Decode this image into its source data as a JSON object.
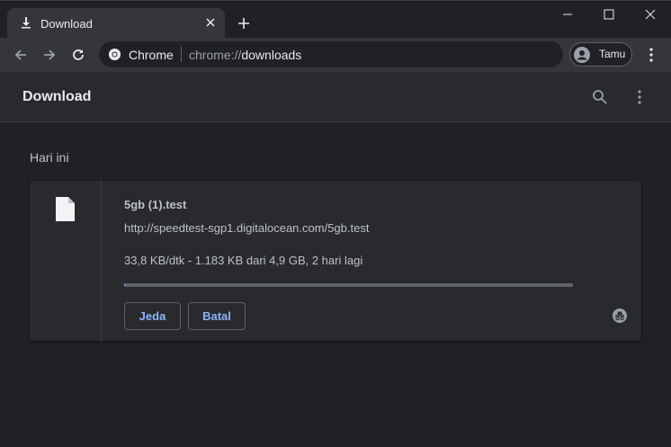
{
  "tab": {
    "title": "Download"
  },
  "omnibox": {
    "chip": "Chrome",
    "url_scheme": "chrome://",
    "url_host": "downloads"
  },
  "profile": {
    "name": "Tamu"
  },
  "downloads": {
    "title": "Download",
    "section_label": "Hari ini",
    "items": [
      {
        "file_name": "5gb (1).test",
        "url": "http://speedtest-sgp1.digitalocean.com/5gb.test",
        "status": "33,8 KB/dtk - 1.183 KB dari 4,9 GB, 2 hari lagi",
        "progress": 0.0002,
        "pause_label": "Jeda",
        "cancel_label": "Batal"
      }
    ]
  },
  "colors": {
    "accent": "#8ab4f8",
    "background": "#202124",
    "surface": "#292a2d"
  }
}
